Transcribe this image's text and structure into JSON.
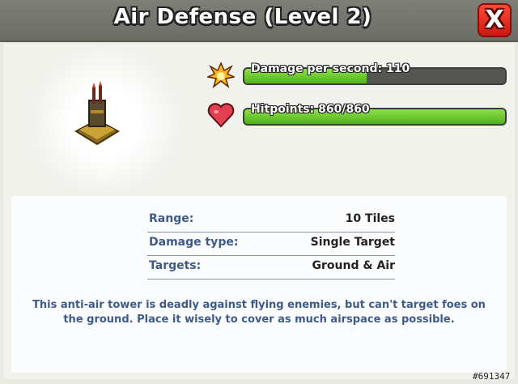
{
  "header": {
    "title": "Air Defense (Level 2)",
    "close_label": "X"
  },
  "stats": [
    {
      "label": "Damage per second: 110",
      "fill_fraction": 0.47,
      "icon": "damage-burst-icon"
    },
    {
      "label": "Hitpoints: 860/860",
      "fill_fraction": 1.0,
      "icon": "heart-icon"
    }
  ],
  "info": {
    "rows": [
      {
        "label": "Range:",
        "value": "10 Tiles"
      },
      {
        "label": "Damage type:",
        "value": "Single Target"
      },
      {
        "label": "Targets:",
        "value": "Ground & Air"
      }
    ],
    "description": "This anti-air tower is deadly against flying enemies, but can't target foes on the ground. Place it wisely to cover as much airspace as possible."
  },
  "watermark": "#691347",
  "colors": {
    "header": "#727369",
    "close": "#e8281c",
    "bar_fill": "#6ccb2e",
    "label_blue": "#3e5a8c"
  }
}
